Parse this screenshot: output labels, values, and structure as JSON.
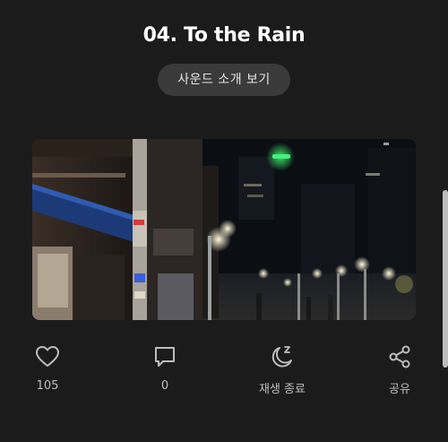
{
  "track": {
    "title": "04. To the Rain",
    "intro_button": "사운드 소개 보기"
  },
  "actions": {
    "like": {
      "icon": "heart-icon",
      "count": "105"
    },
    "comment": {
      "icon": "comment-icon",
      "count": "0"
    },
    "sleep_timer": {
      "icon": "moon-sleep-icon",
      "label": "재생 종료"
    },
    "share": {
      "icon": "share-icon",
      "label": "공유"
    }
  },
  "colors": {
    "background": "#1b1b1b",
    "button_bg": "#3a3a3a",
    "icon_gray": "#bdbdbd"
  }
}
